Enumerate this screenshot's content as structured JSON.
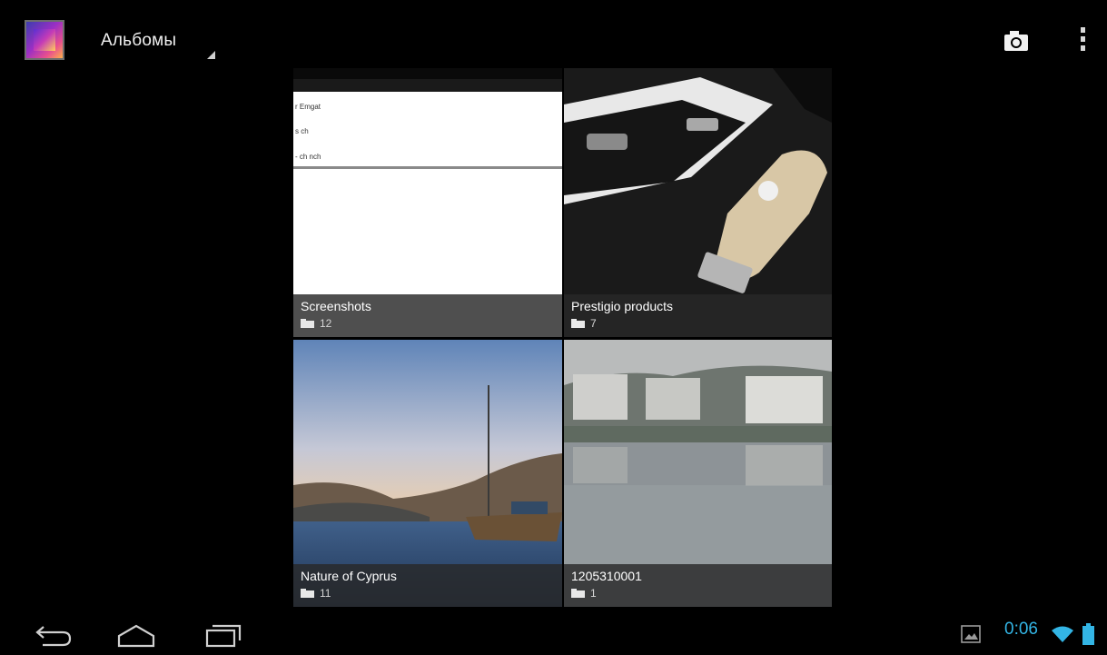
{
  "action_bar": {
    "app_icon": "gallery-app-icon",
    "title": "Альбомы",
    "actions": [
      {
        "name": "camera-icon"
      },
      {
        "name": "overflow-menu-icon"
      }
    ]
  },
  "albums": [
    {
      "name": "Screenshots",
      "count": "12",
      "thumbnail_text": [
        "r Emgat",
        "s ch",
        "- ch nch"
      ]
    },
    {
      "name": "Prestigio products",
      "count": "7"
    },
    {
      "name": "Nature of Cyprus",
      "count": "11"
    },
    {
      "name": "1205310001",
      "count": "1"
    }
  ],
  "status_bar": {
    "time": "0:06",
    "icons": [
      "gallery-notification-icon",
      "wifi-icon",
      "battery-icon"
    ],
    "accent_color": "#33b5e5"
  },
  "nav_bar": {
    "buttons": [
      "back-icon",
      "home-icon",
      "recent-apps-icon"
    ]
  }
}
